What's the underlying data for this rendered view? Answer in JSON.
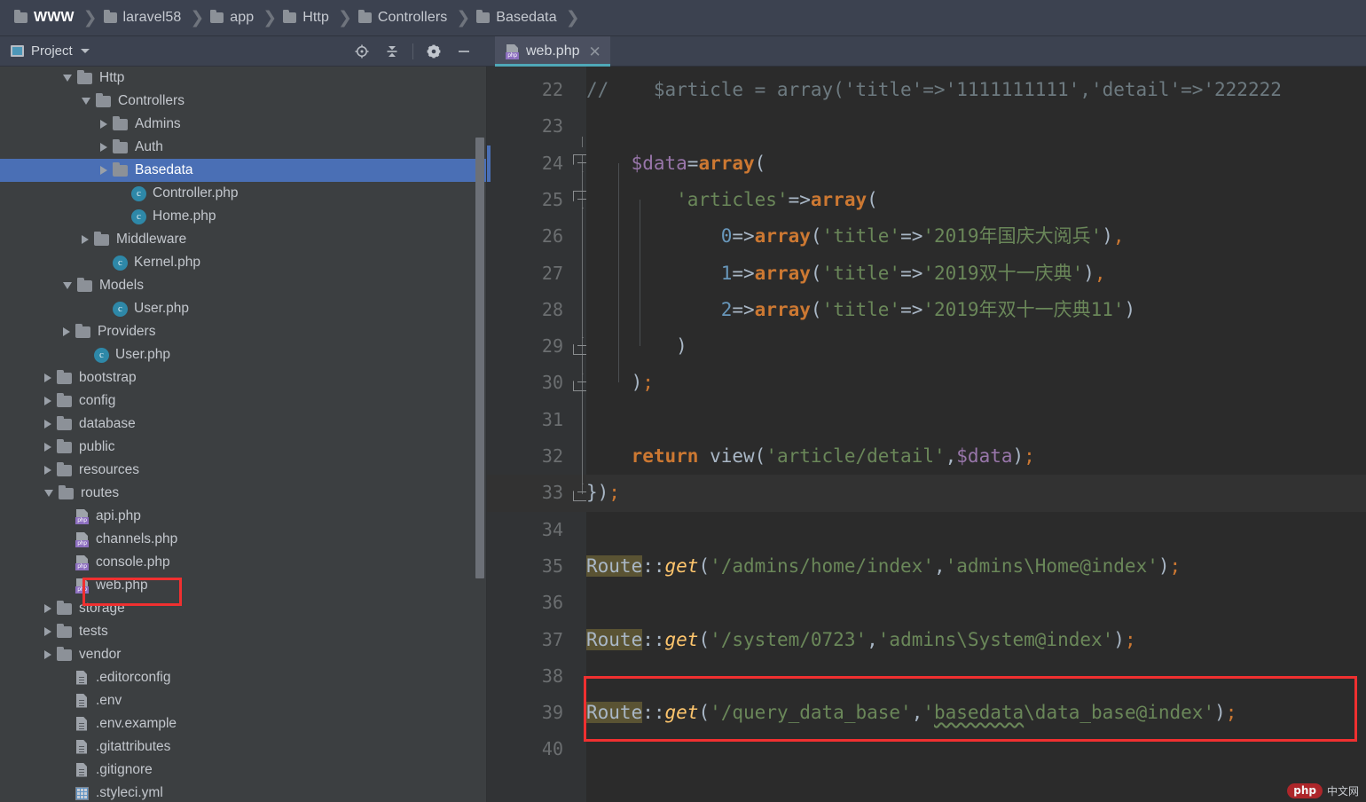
{
  "breadcrumb": {
    "name": "breadcrumb",
    "items": [
      {
        "label": "WWW",
        "icon": "folder-icon"
      },
      {
        "label": "laravel58",
        "icon": "folder-icon"
      },
      {
        "label": "app",
        "icon": "folder-icon"
      },
      {
        "label": "Http",
        "icon": "folder-icon"
      },
      {
        "label": "Controllers",
        "icon": "folder-icon"
      },
      {
        "label": "Basedata",
        "icon": "folder-icon"
      }
    ],
    "separator": "❯"
  },
  "tool_window": {
    "title": "Project",
    "caret": "chevron-down-icon",
    "actions": [
      {
        "name": "locate-icon",
        "glyph": "target"
      },
      {
        "name": "collapse-all-icon",
        "glyph": "collapse"
      },
      {
        "name": "settings-gear-icon",
        "glyph": "gear"
      },
      {
        "name": "hide-icon",
        "glyph": "minus"
      }
    ]
  },
  "tabs": [
    {
      "label": "web.php",
      "icon": "php-file-icon",
      "close": "✕",
      "active": true
    }
  ],
  "tree": [
    {
      "label": "Http",
      "kind": "folder",
      "indent": 3,
      "state": "open"
    },
    {
      "label": "Controllers",
      "kind": "folder",
      "indent": 4,
      "state": "open"
    },
    {
      "label": "Admins",
      "kind": "folder",
      "indent": 5,
      "state": "closed"
    },
    {
      "label": "Auth",
      "kind": "folder",
      "indent": 5,
      "state": "closed"
    },
    {
      "label": "Basedata",
      "kind": "folder",
      "indent": 5,
      "state": "closed",
      "selected": true
    },
    {
      "label": "Controller.php",
      "kind": "class",
      "indent": 6,
      "state": "none"
    },
    {
      "label": "Home.php",
      "kind": "class",
      "indent": 6,
      "state": "none"
    },
    {
      "label": "Middleware",
      "kind": "folder",
      "indent": 4,
      "state": "closed"
    },
    {
      "label": "Kernel.php",
      "kind": "class",
      "indent": 5,
      "state": "none"
    },
    {
      "label": "Models",
      "kind": "folder",
      "indent": 3,
      "state": "open"
    },
    {
      "label": "User.php",
      "kind": "class",
      "indent": 5,
      "state": "none"
    },
    {
      "label": "Providers",
      "kind": "folder",
      "indent": 3,
      "state": "closed"
    },
    {
      "label": "User.php",
      "kind": "class",
      "indent": 4,
      "state": "none"
    },
    {
      "label": "bootstrap",
      "kind": "folder",
      "indent": 2,
      "state": "closed"
    },
    {
      "label": "config",
      "kind": "folder",
      "indent": 2,
      "state": "closed"
    },
    {
      "label": "database",
      "kind": "folder",
      "indent": 2,
      "state": "closed"
    },
    {
      "label": "public",
      "kind": "folder",
      "indent": 2,
      "state": "closed"
    },
    {
      "label": "resources",
      "kind": "folder",
      "indent": 2,
      "state": "closed"
    },
    {
      "label": "routes",
      "kind": "folder",
      "indent": 2,
      "state": "open"
    },
    {
      "label": "api.php",
      "kind": "php",
      "indent": 3,
      "state": "none"
    },
    {
      "label": "channels.php",
      "kind": "php",
      "indent": 3,
      "state": "none"
    },
    {
      "label": "console.php",
      "kind": "php",
      "indent": 3,
      "state": "none"
    },
    {
      "label": "web.php",
      "kind": "php",
      "indent": 3,
      "state": "none",
      "highlighted": true
    },
    {
      "label": "storage",
      "kind": "folder",
      "indent": 2,
      "state": "closed"
    },
    {
      "label": "tests",
      "kind": "folder",
      "indent": 2,
      "state": "closed"
    },
    {
      "label": "vendor",
      "kind": "folder",
      "indent": 2,
      "state": "closed"
    },
    {
      "label": ".editorconfig",
      "kind": "doc",
      "indent": 3,
      "state": "none"
    },
    {
      "label": ".env",
      "kind": "doc",
      "indent": 3,
      "state": "none"
    },
    {
      "label": ".env.example",
      "kind": "doc",
      "indent": 3,
      "state": "none"
    },
    {
      "label": ".gitattributes",
      "kind": "doc",
      "indent": 3,
      "state": "none"
    },
    {
      "label": ".gitignore",
      "kind": "doc",
      "indent": 3,
      "state": "none"
    },
    {
      "label": ".styleci.yml",
      "kind": "grid",
      "indent": 3,
      "state": "none"
    }
  ],
  "editor": {
    "first_line": 22,
    "last_line": 40,
    "line_numbers": [
      "22",
      "23",
      "24",
      "25",
      "26",
      "27",
      "28",
      "29",
      "30",
      "31",
      "32",
      "33",
      "34",
      "35",
      "36",
      "37",
      "38",
      "39",
      "40"
    ],
    "current_line": 33,
    "lines": [
      {
        "n": 22,
        "text": "//    $article = array('title'=>'1111111111','detail'=>'222222"
      },
      {
        "n": 23,
        "text": ""
      },
      {
        "n": 24,
        "text": "    $data=array("
      },
      {
        "n": 25,
        "text": "        'articles'=>array("
      },
      {
        "n": 26,
        "text": "            0=>array('title'=>'2019年国庆大阅兵'),"
      },
      {
        "n": 27,
        "text": "            1=>array('title'=>'2019双十一庆典'),"
      },
      {
        "n": 28,
        "text": "            2=>array('title'=>'2019年双十一庆典11')"
      },
      {
        "n": 29,
        "text": "        )"
      },
      {
        "n": 30,
        "text": "    );"
      },
      {
        "n": 31,
        "text": ""
      },
      {
        "n": 32,
        "text": "    return view('article/detail',$data);"
      },
      {
        "n": 33,
        "text": "});"
      },
      {
        "n": 34,
        "text": ""
      },
      {
        "n": 35,
        "text": "Route::get('/admins/home/index','admins\\Home@index');"
      },
      {
        "n": 36,
        "text": ""
      },
      {
        "n": 37,
        "text": "Route::get('/system/0723','admins\\System@index');"
      },
      {
        "n": 38,
        "text": ""
      },
      {
        "n": 39,
        "text": "Route::get('/query_data_base','basedata\\data_base@index');"
      },
      {
        "n": 40,
        "text": ""
      }
    ],
    "fold_markers": [
      {
        "line": 24,
        "dir": "down"
      },
      {
        "line": 25,
        "dir": "down"
      },
      {
        "line": 29,
        "dir": "up"
      },
      {
        "line": 30,
        "dir": "up"
      },
      {
        "line": 33,
        "dir": "up"
      }
    ],
    "annotation_boxes": [
      {
        "name": "highlight-box-line-39",
        "color": "#f03030"
      }
    ]
  },
  "watermark": {
    "badge": "php",
    "text": "中文网"
  },
  "colors": {
    "selection": "#4a6fb5",
    "annotation": "#f03030",
    "tab_underline": "#4fa8b8",
    "editor_bg": "#2b2b2b",
    "panel_bg": "#3c3f41",
    "header_bg": "#3c4250",
    "string": "#6a8759",
    "keyword": "#cc7832",
    "function": "#ffc66d",
    "variable": "#9876aa",
    "number": "#6897bb",
    "comment": "#6d7a80",
    "identifier_highlight": "#5a5333"
  }
}
